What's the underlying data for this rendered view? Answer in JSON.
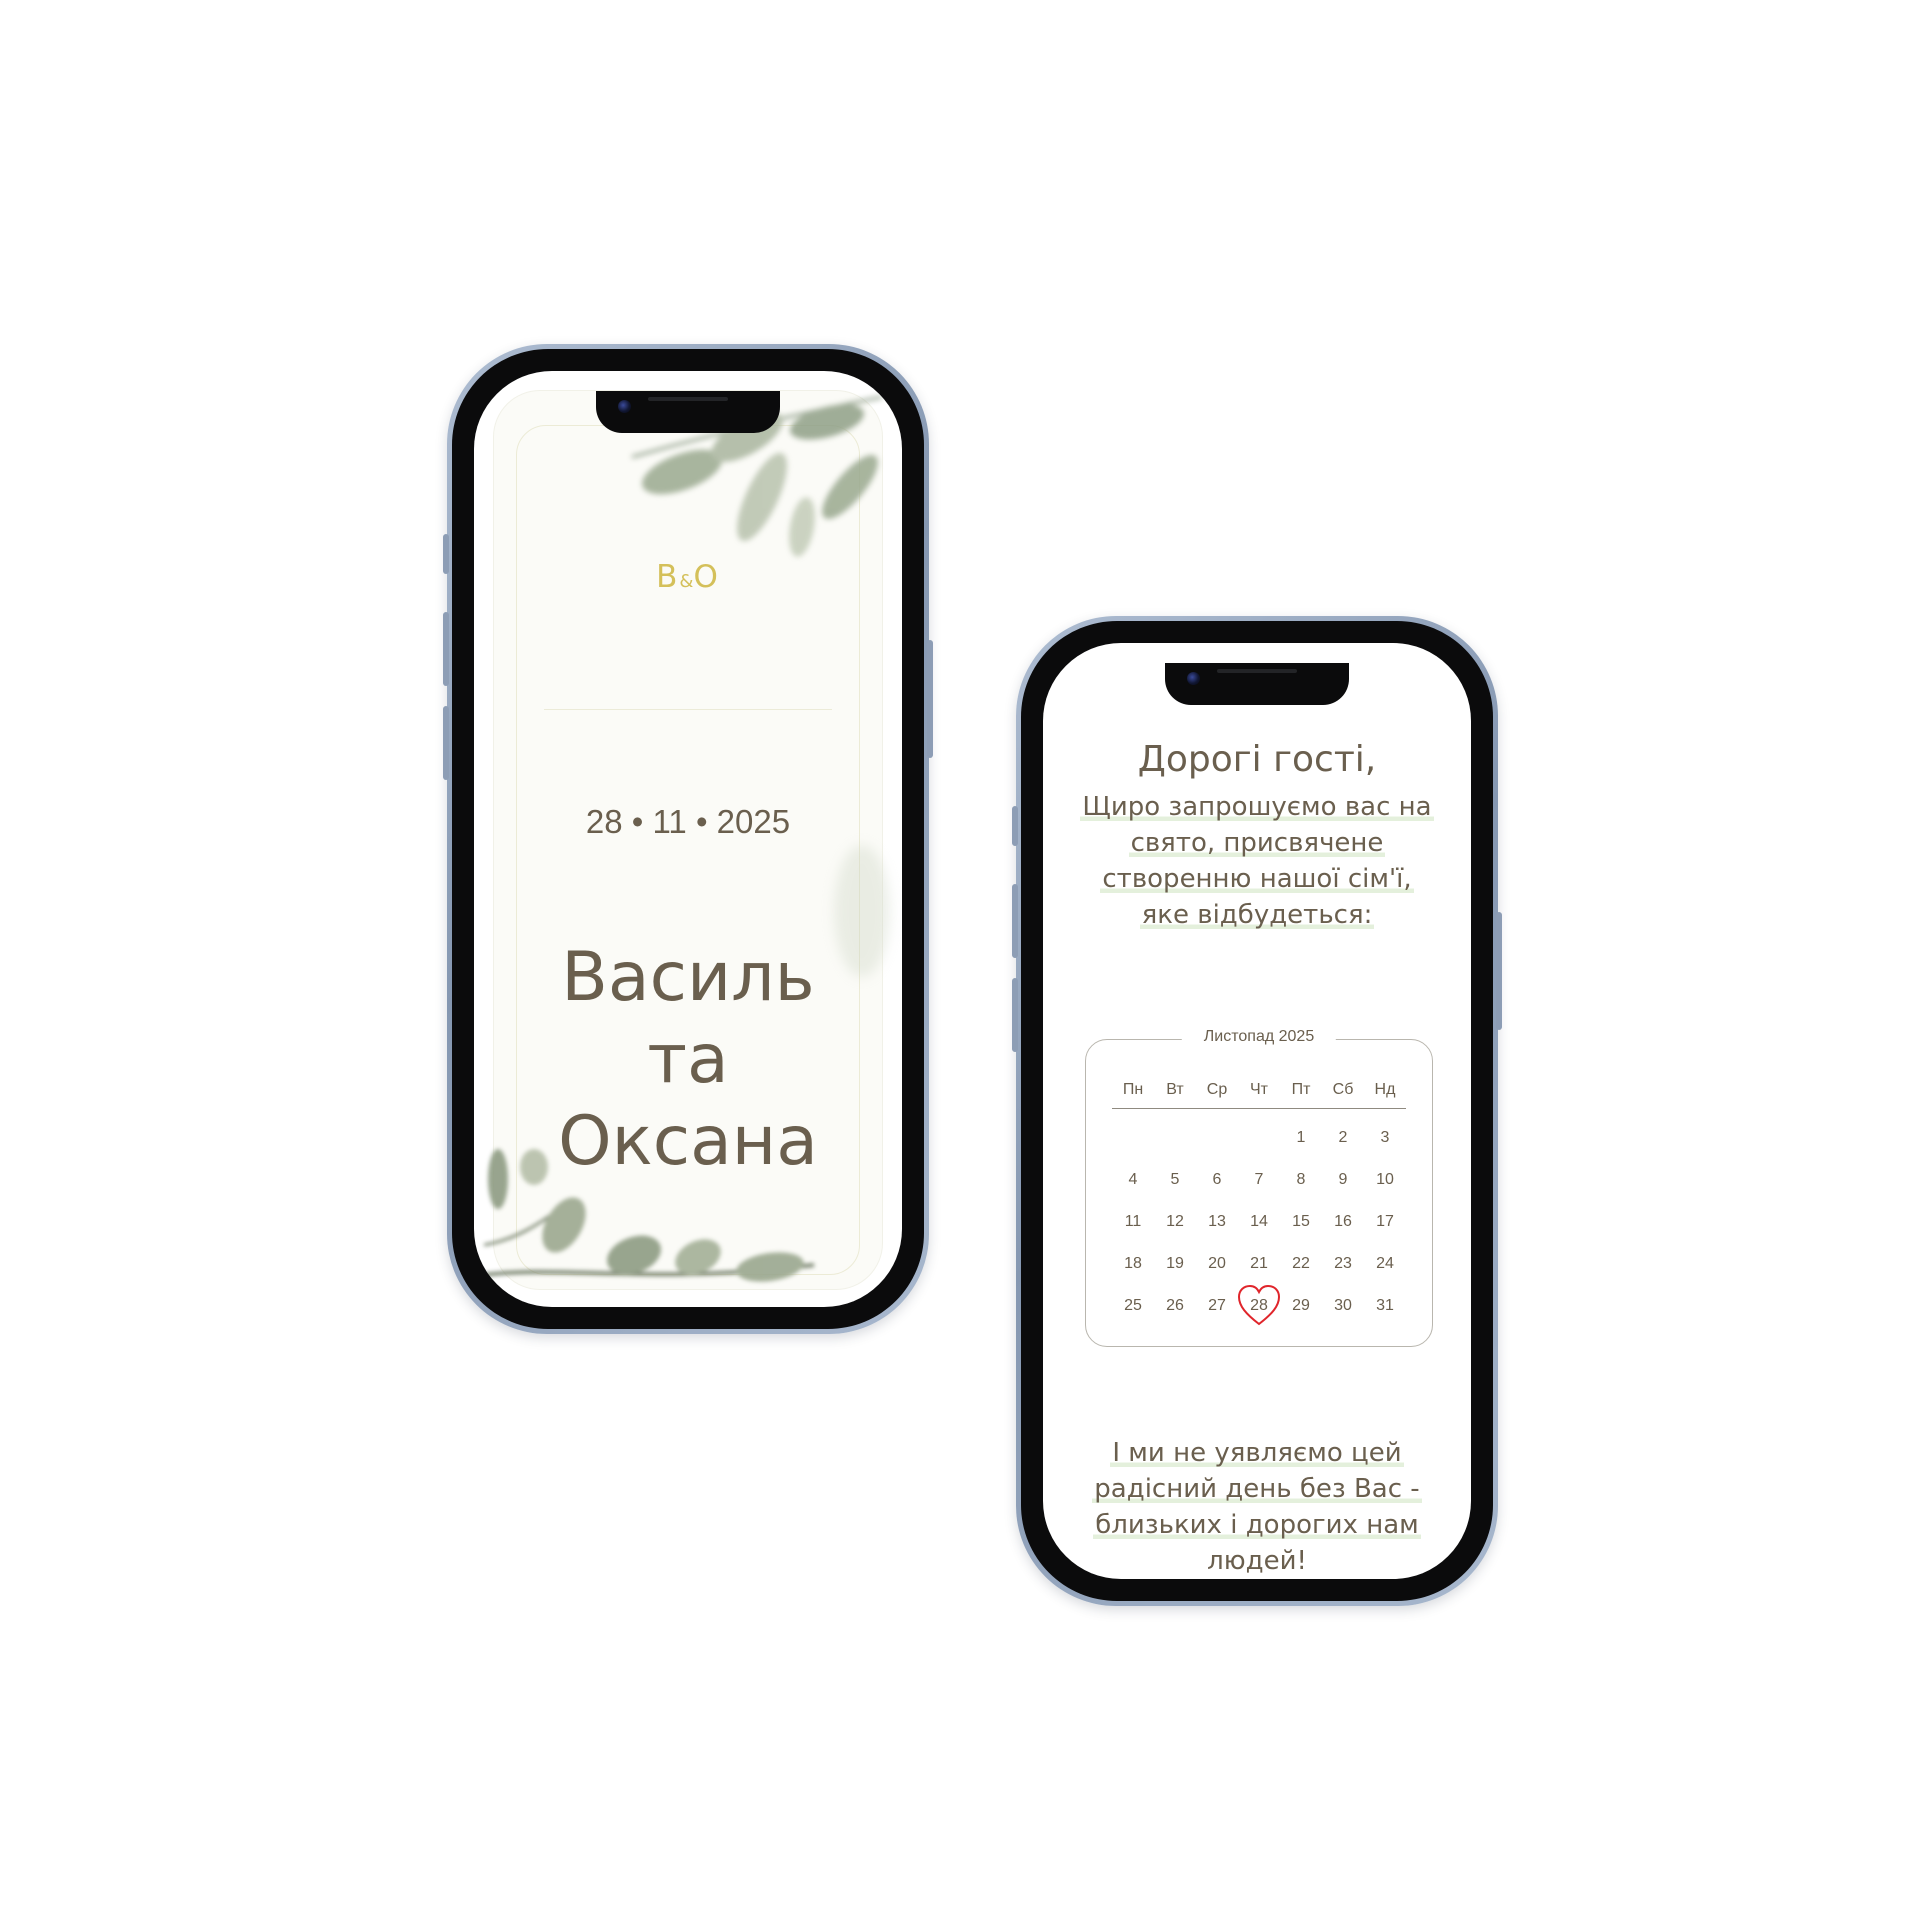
{
  "phone1": {
    "monogram": {
      "left": "B",
      "amp": "&",
      "right": "O"
    },
    "date": "28 • 11 • 2025",
    "names": [
      "Василь",
      "та",
      "Оксана"
    ],
    "accent_color": "#d4c05a",
    "text_color": "#6a5f4e"
  },
  "phone2": {
    "greeting": "Дорогі гості,",
    "invite_lines": [
      "Щиро запрошуємо вас на",
      "свято, присвячене",
      "створенню нашої сім'ї,",
      "яке відбудеться:"
    ],
    "calendar": {
      "title": "Листопад 2025",
      "weekdays": [
        "Пн",
        "Вт",
        "Ср",
        "Чт",
        "Пт",
        "Сб",
        "Нд"
      ],
      "weeks": [
        [
          "",
          "",
          "",
          "",
          "1",
          "2",
          "3"
        ],
        [
          "4",
          "5",
          "6",
          "7",
          "8",
          "9",
          "10"
        ],
        [
          "11",
          "12",
          "13",
          "14",
          "15",
          "16",
          "17"
        ],
        [
          "18",
          "19",
          "20",
          "21",
          "22",
          "23",
          "24"
        ],
        [
          "25",
          "26",
          "27",
          "28",
          "29",
          "30",
          "31"
        ]
      ],
      "highlighted_day": "28",
      "highlight_color": "#e0252b",
      "highlight_icon": "heart-icon"
    },
    "closing_lines": [
      "І ми не уявляємо цей",
      "радісний день без Вас -",
      "близьких і дорогих нам",
      "людей!"
    ],
    "highlight_bg": "#e4f0dc"
  }
}
